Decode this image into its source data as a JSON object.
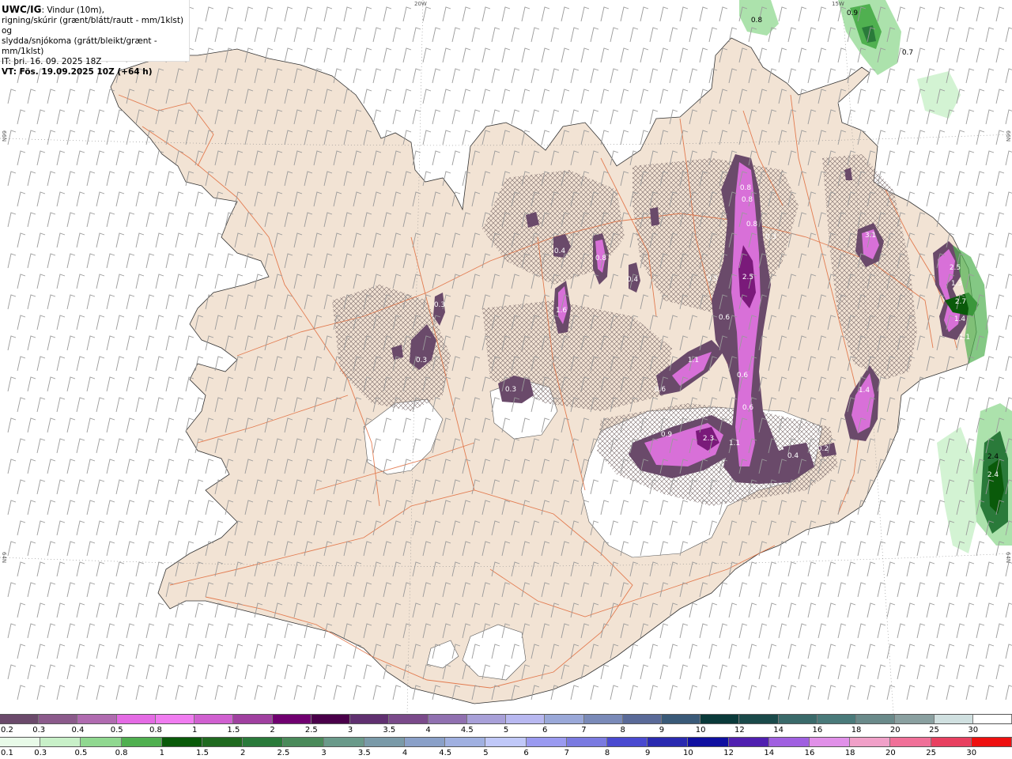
{
  "header": {
    "product": "UWC/IG",
    "line1": ": Vindur (10m),",
    "line2": "rigning/skúrir (grænt/blátt/rautt - mm/1klst) og",
    "line3": "slydda/snjókoma (grátt/bleikt/grænt - mm/1klst)",
    "issue": "IT: þri. 16. 09. 2025 18Z",
    "valid": "VT: Fös. 19.09.2025 10Z (+64 h)"
  },
  "grid_labels": {
    "lon_20w": "20W",
    "lon_15w": "15W",
    "lat_66n_left": "66N",
    "lat_66n_right": "66N",
    "lat_64n_left": "64N",
    "lat_64n_right": "64N"
  },
  "precip_labels": [
    {
      "text": "0.8"
    },
    {
      "text": "0.8"
    },
    {
      "text": "0.8"
    },
    {
      "text": "0.3"
    },
    {
      "text": "0.5"
    },
    {
      "text": "2.5"
    },
    {
      "text": "0.6"
    },
    {
      "text": "1.1"
    },
    {
      "text": "0.6"
    },
    {
      "text": "0.6"
    },
    {
      "text": "0.6"
    },
    {
      "text": "0.9"
    },
    {
      "text": "2.3"
    },
    {
      "text": "1.1"
    },
    {
      "text": "0.4"
    },
    {
      "text": "0.2"
    },
    {
      "text": "3.1"
    },
    {
      "text": "1.4"
    },
    {
      "text": "2.5"
    },
    {
      "text": "1.3"
    },
    {
      "text": "2.7"
    },
    {
      "text": "1.4"
    },
    {
      "text": "1.1"
    },
    {
      "text": "0.4"
    },
    {
      "text": "0.8"
    },
    {
      "text": "1.6"
    },
    {
      "text": "0.4"
    },
    {
      "text": "0.3"
    },
    {
      "text": "0.3"
    },
    {
      "text": "0.8"
    },
    {
      "text": "0.9"
    },
    {
      "text": "0.7"
    },
    {
      "text": "2.4"
    },
    {
      "text": "2.4"
    },
    {
      "text": "0.3"
    }
  ],
  "snow_scale": {
    "labels": [
      "0.2",
      "0.3",
      "0.4",
      "0.5",
      "0.8",
      "1",
      "1.5",
      "2",
      "2.5",
      "3",
      "3.5",
      "4",
      "4.5",
      "5",
      "6",
      "7",
      "8",
      "9",
      "10",
      "12",
      "14",
      "16",
      "18",
      "20",
      "25",
      "30"
    ],
    "colors": [
      "#6b4a6b",
      "#8b5a8b",
      "#b06bb0",
      "#e46be4",
      "#f07cf0",
      "#d060d0",
      "#a040a0",
      "#700070",
      "#4a004a",
      "#603070",
      "#7a4a8a",
      "#9070b0",
      "#a8a0d8",
      "#b8b8f0",
      "#9aa8d8",
      "#7a8ab8",
      "#5a6a98",
      "#3a5a78",
      "#0a3a3a",
      "#1a4a4a",
      "#3a6a6a",
      "#4a7a7a",
      "#6a8a8a",
      "#8aa0a0",
      "#d0e0e0",
      "#ffffff"
    ]
  },
  "rain_scale": {
    "labels": [
      "0.1",
      "0.3",
      "0.5",
      "0.8",
      "1",
      "1.5",
      "2",
      "2.5",
      "3",
      "3.5",
      "4",
      "4.5",
      "5",
      "6",
      "7",
      "8",
      "9",
      "10",
      "12",
      "14",
      "16",
      "18",
      "20",
      "25",
      "30"
    ],
    "colors": [
      "#e8fae8",
      "#c8f0c8",
      "#90d890",
      "#50b050",
      "#0a5a0a",
      "#206a20",
      "#2a7a3a",
      "#4a8a5a",
      "#6a9a8a",
      "#7a9aa8",
      "#8aa0c8",
      "#a0b0e0",
      "#c0c8f8",
      "#9a9af0",
      "#7a7ae0",
      "#4a4ad0",
      "#2a2ab0",
      "#1010a0",
      "#5020b0",
      "#a060e0",
      "#e090e8",
      "#f0a0c8",
      "#f07098",
      "#e84060",
      "#ee1010"
    ]
  }
}
